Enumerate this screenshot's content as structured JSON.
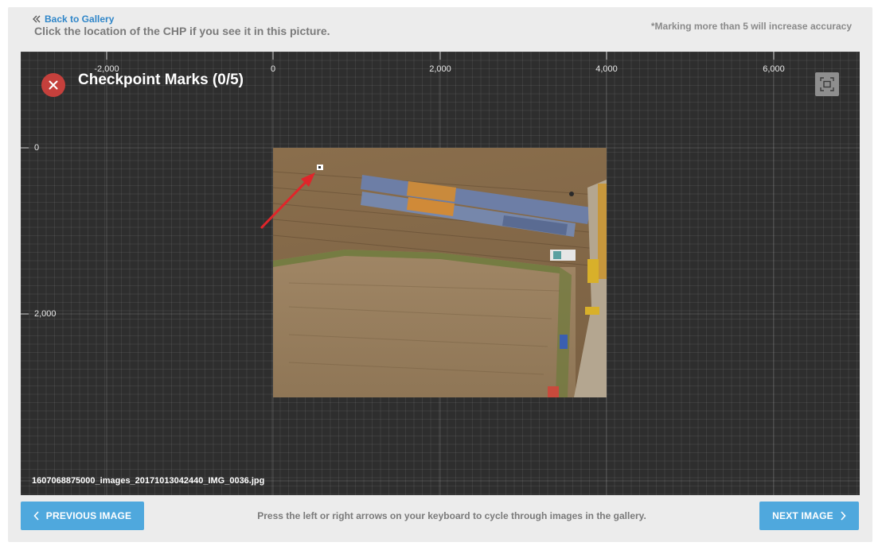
{
  "header": {
    "back_label": "Back to Gallery",
    "instruction": "Click the location of the CHP if you see it in this picture.",
    "hint": "*Marking more than 5 will increase accuracy"
  },
  "viewer": {
    "title": "Checkpoint Marks (0/5)",
    "x_ticks": [
      "-2,000",
      "0",
      "2,000",
      "4,000",
      "6,000"
    ],
    "y_ticks": [
      "0",
      "2,000"
    ],
    "filename": "1607068875000_images_20171013042440_IMG_0036.jpg",
    "close_icon": "close-icon",
    "fit_icon": "fit-screen-icon",
    "accent_close": "#c5403c"
  },
  "footer": {
    "prev_label": "PREVIOUS IMAGE",
    "next_label": "NEXT IMAGE",
    "help_text": "Press the left or right arrows on your keyboard to cycle through images in the gallery.",
    "button_color": "#4fa8dd"
  }
}
